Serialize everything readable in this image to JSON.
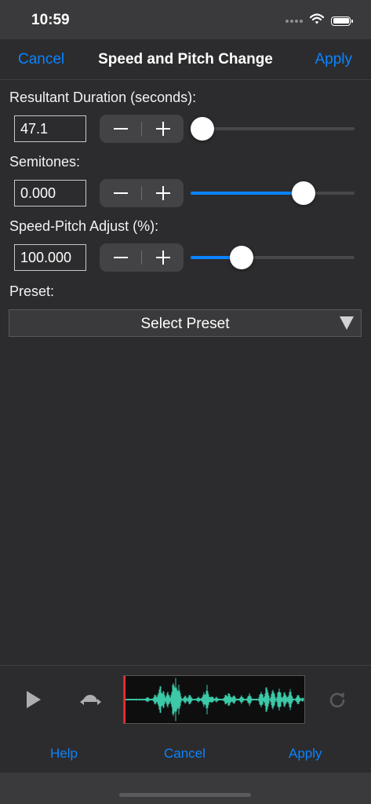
{
  "status_bar": {
    "time": "10:59",
    "icons": [
      "signal-dots-icon",
      "wifi-icon",
      "battery-icon"
    ]
  },
  "nav": {
    "left_label": "Cancel",
    "title": "Speed and Pitch Change",
    "right_label": "Apply"
  },
  "duration": {
    "label": "Resultant Duration (seconds):",
    "value": "47.1",
    "slider_fraction": 0.0
  },
  "semitones": {
    "label": "Semitones:",
    "value": "0.000",
    "slider_fraction": 0.72
  },
  "speed_pitch": {
    "label": "Speed-Pitch Adjust (%):",
    "value": "100.000",
    "slider_fraction": 0.28
  },
  "preset": {
    "label": "Preset:",
    "selected": "Select Preset"
  },
  "player": {
    "icons": [
      "play-icon",
      "scrub-icon",
      "reset-icon"
    ],
    "waveform_color": "#3cc9a8",
    "marker_color": "#ff2d2d"
  },
  "tabbar": {
    "help": "Help",
    "cancel": "Cancel",
    "apply": "Apply"
  },
  "colors": {
    "accent": "#0a84ff",
    "background": "#2c2c2e",
    "panel": "#3a3a3c"
  }
}
